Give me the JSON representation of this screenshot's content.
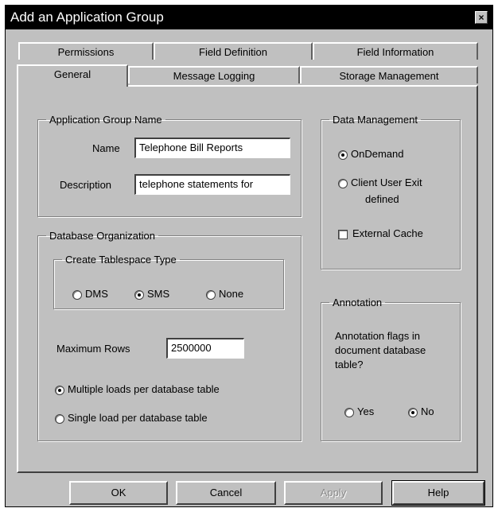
{
  "window": {
    "title": "Add an Application Group",
    "close_glyph": "×"
  },
  "tabs": {
    "back_row": [
      "Permissions",
      "Field Definition",
      "Field Information"
    ],
    "front_row": [
      "General",
      "Message Logging",
      "Storage Management"
    ],
    "active": "General"
  },
  "app_group_name": {
    "legend": "Application Group Name",
    "name_label": "Name",
    "name_value": "Telephone Bill Reports",
    "description_label": "Description",
    "description_value": "telephone statements for"
  },
  "database_org": {
    "legend": "Database Organization",
    "tablespace": {
      "legend": "Create Tablespace Type",
      "options": [
        "DMS",
        "SMS",
        "None"
      ],
      "selected": "SMS"
    },
    "max_rows_label": "Maximum Rows",
    "max_rows_value": "2500000",
    "load_options": [
      "Multiple loads per database table",
      "Single load per database table"
    ],
    "load_selected": "Multiple loads per database table"
  },
  "data_management": {
    "legend": "Data Management",
    "ondemand_label": "OnDemand",
    "client_exit_label_1": "Client User Exit",
    "client_exit_label_2": "defined",
    "selected": "OnDemand",
    "external_cache_label": "External Cache",
    "external_cache_checked": false
  },
  "annotation": {
    "legend": "Annotation",
    "question_1": "Annotation flags in",
    "question_2": "document database",
    "question_3": "table?",
    "yes_label": "Yes",
    "no_label": "No",
    "selected": "No"
  },
  "buttons": {
    "ok": "OK",
    "cancel": "Cancel",
    "apply": "Apply",
    "help": "Help"
  }
}
